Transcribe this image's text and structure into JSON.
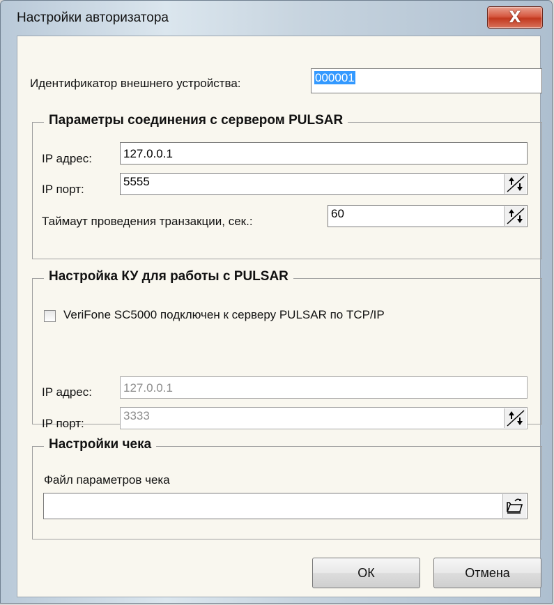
{
  "window": {
    "title": "Настройки авторизатора",
    "close_label": "X"
  },
  "device": {
    "label": "Идентификатор внешнего устройства:",
    "value": "000001"
  },
  "server_group": {
    "legend": "Параметры соединения с сервером PULSAR",
    "ip_label": "IP адрес:",
    "ip_value": "127.0.0.1",
    "port_label": "IP порт:",
    "port_value": "5555",
    "timeout_label": "Таймаут проведения транзакции, сек.:",
    "timeout_value": "60"
  },
  "ku_group": {
    "legend": "Настройка КУ для работы с PULSAR",
    "checkbox_label": "VeriFone SC5000 подключен к серверу PULSAR по TCP/IP",
    "checkbox_checked": false,
    "ip_label": "IP адрес:",
    "ip_value": "127.0.0.1",
    "port_label": "IP порт:",
    "port_value": "3333"
  },
  "receipt_group": {
    "legend": "Настройки чека",
    "file_label": "Файл параметров чека",
    "file_value": ""
  },
  "buttons": {
    "ok": "ОК",
    "cancel": "Отмена"
  },
  "icons": {
    "spin": "spin-arrows-icon",
    "browse": "open-folder-icon",
    "close": "close-icon"
  }
}
